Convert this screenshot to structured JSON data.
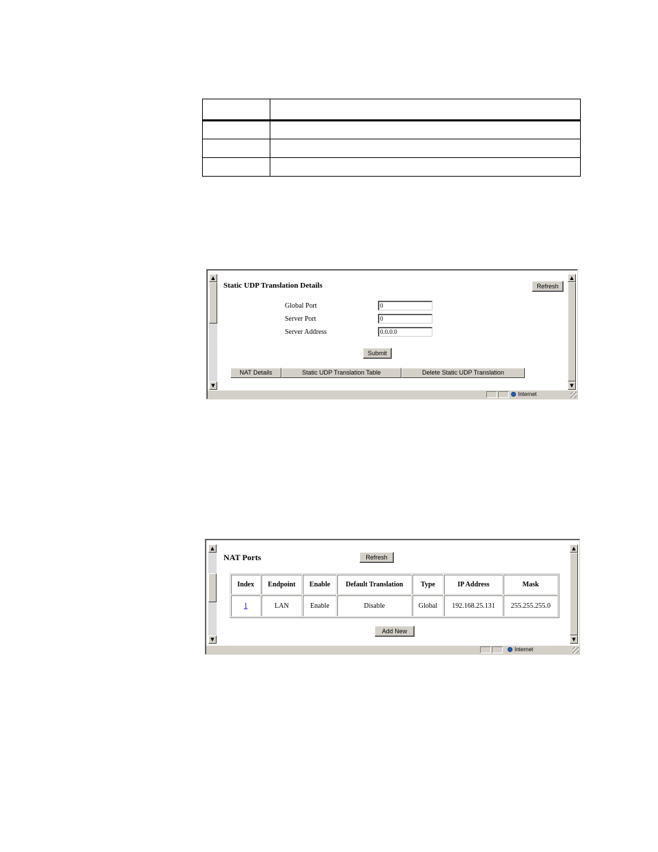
{
  "udp_window": {
    "title": "Static UDP Translation Details",
    "refresh_label": "Refresh",
    "fields": [
      {
        "label": "Global Port",
        "value": "0"
      },
      {
        "label": "Server Port",
        "value": "0"
      },
      {
        "label": "Server Address",
        "value": "0.0.0.0"
      }
    ],
    "submit_label": "Submit",
    "nav_tabs": [
      "NAT Details",
      "Static UDP Translation Table",
      "Delete Static UDP Translation"
    ],
    "status_zone": "Internet"
  },
  "nat_window": {
    "title": "NAT Ports",
    "refresh_label": "Refresh",
    "table": {
      "headers": [
        "Index",
        "Endpoint",
        "Enable",
        "Default Translation",
        "Type",
        "IP Address",
        "Mask"
      ],
      "rows": [
        [
          "1",
          "LAN",
          "Enable",
          "Disable",
          "Global",
          "192.168.25.131",
          "255.255.255.0"
        ]
      ]
    },
    "add_new_label": "Add New",
    "status_zone": "Internet"
  }
}
